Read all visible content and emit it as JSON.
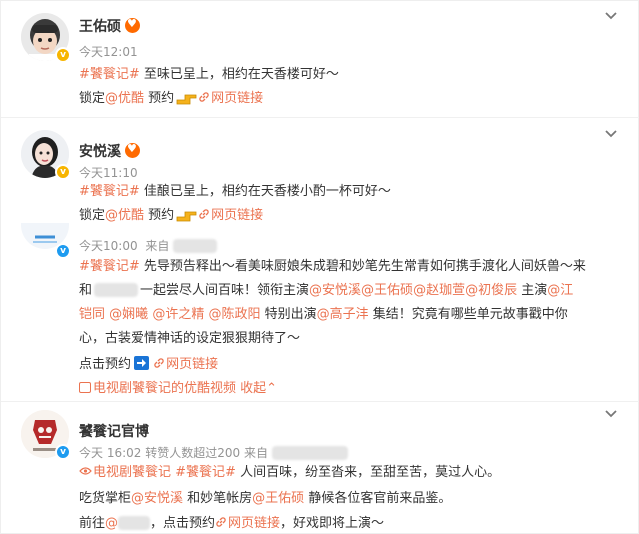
{
  "post1": {
    "username": "王佑硕",
    "time": "今天12:01",
    "tag": "#饕餮记#",
    "text": " 至味已呈上，相约在天香楼可好～",
    "lock_prefix": "锁定",
    "lock_at": "@优酷",
    "reserve": " 预约",
    "link_label": "网页链接"
  },
  "post2": {
    "username": "安悦溪",
    "time": "今天11:10",
    "tag": "#饕餮记#",
    "text": " 佳酿已呈上，相约在天香楼小酌一杯可好～",
    "lock_prefix": "锁定",
    "lock_at": "@优酷",
    "reserve": " 预约",
    "link_label": "网页链接"
  },
  "post3": {
    "time": "今天10:00",
    "source_prefix": "来自",
    "line1_tag": "#饕餮记#",
    "line1_text": " 先导预告释出～看美味厨娘朱成碧和妙笔先生常青如何携手渡化人间妖兽～来",
    "line2_prefix": "和",
    "line2_text": "一起尝尽人间百味！领衔主演",
    "at_anyuexi": "@安悦溪",
    "at_wangyoushuo": "@王佑硕",
    "at_zhaojiaxuan": "@赵珈萱",
    "at_chujunchen": "@初俊辰",
    "starring": " 主演",
    "at_jiangkaitong_a": "@江",
    "at_jiangkaitong_b": "铠同",
    "at_jianxi": "@娴曦",
    "at_xuzhijing": "@许之精",
    "at_chenzhengyang": "@陈政阳",
    "special": " 特别出演",
    "at_gaozifeng": "@高子沣",
    "gather": " 集结！究竟有哪些单元故事戳中你",
    "line4": "心，古装爱情神话的设定狠狠期待了～",
    "reserve_text": "点击预约",
    "link_label": "网页链接",
    "video_text": "电视剧饕餮记的优酷视频",
    "collapse": " 收起",
    "collapse_arrow": "⌃"
  },
  "post4": {
    "username": "饕餮记官博",
    "time": "今天 16:02",
    "reposts": " 转赞人数超过200 ",
    "source_prefix": "来自",
    "super_topic": "电视剧饕餮记",
    "tag": "#饕餮记#",
    "text1": " 人间百味，纷至沓来，至甜至苦，莫过人心。",
    "l2_prefix": "吃货掌柜",
    "at_anyuexi": "@安悦溪",
    "l2_mid": " 和妙笔帐房",
    "at_wangyoushuo": "@王佑硕",
    "l2_end": " 静候各位客官前来品鉴。",
    "l3_prefix": "前往",
    "l3_at": "@",
    "l3_mid": "，点击预约",
    "link_label": "网页链接",
    "l3_end": "，好戏即将上演～"
  },
  "colors": {
    "accent": "#eb7350",
    "meta": "#939393",
    "text": "#333333",
    "verified_gold": "#f7b500",
    "verified_blue": "#1d9bf0"
  }
}
